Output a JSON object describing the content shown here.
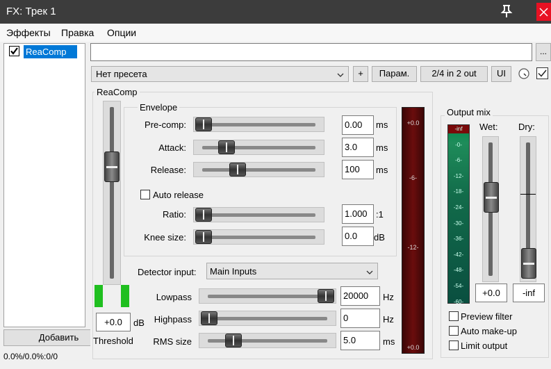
{
  "window": {
    "title": "FX: Трек 1"
  },
  "menu": {
    "items": [
      "Эффекты",
      "Правка",
      "Опции"
    ]
  },
  "fx_list": {
    "items": [
      {
        "label": "ReaComp",
        "enabled": true
      }
    ],
    "add_label": "Добавить",
    "status": "0.0%/0.0%:0/0"
  },
  "toolbar": {
    "name_value": "",
    "ellipsis": "...",
    "preset": "Нет пресета",
    "plus": "+",
    "params": "Парам.",
    "routing": "2/4 in 2 out",
    "ui": "UI",
    "ui_checked": true
  },
  "plugin": {
    "title": "ReaComp",
    "threshold": {
      "value": "+0.0",
      "unit": "dB",
      "label": "Threshold",
      "level": 0.0
    },
    "envelope": {
      "title": "Envelope",
      "precomp": {
        "label": "Pre-comp:",
        "value": "0.00",
        "unit": "ms",
        "pos": 0.0
      },
      "attack": {
        "label": "Attack:",
        "value": "3.0",
        "unit": "ms",
        "pos": 0.21
      },
      "release": {
        "label": "Release:",
        "value": "100",
        "unit": "ms",
        "pos": 0.31
      },
      "auto_release": {
        "label": "Auto release",
        "checked": false
      },
      "ratio": {
        "label": "Ratio:",
        "value": "1.000",
        "unit": ":1",
        "pos": 0.0
      },
      "knee": {
        "label": "Knee size:",
        "value": "0.0",
        "unit": "dB",
        "pos": 0.0
      }
    },
    "detector": {
      "label": "Detector input:",
      "value": "Main Inputs"
    },
    "lowpass": {
      "label": "Lowpass",
      "value": "20000",
      "unit": "Hz",
      "pos": 1.0
    },
    "highpass": {
      "label": "Highpass",
      "value": "0",
      "unit": "Hz",
      "pos": 0.0
    },
    "rms": {
      "label": "RMS size",
      "value": "5.0",
      "unit": "ms",
      "pos": 0.21
    },
    "gr_meter": {
      "top": "+0.0",
      "mid1": "-6-",
      "mid2": "-12-",
      "bottom": "+0.0"
    },
    "output_mix": {
      "title": "Output mix",
      "meter_labels": [
        "-inf",
        "-0-",
        "-6-",
        "-12-",
        "-18-",
        "-24-",
        "-30-",
        "-36-",
        "-42-",
        "-48-",
        "-54-",
        "-60-"
      ],
      "wet": {
        "label": "Wet:",
        "value": "+0.0",
        "level": 0.4
      },
      "dry": {
        "label": "Dry:",
        "value": "-inf",
        "level": 1.0
      },
      "preview_filter": {
        "label": "Preview filter",
        "checked": false
      },
      "auto_makeup": {
        "label": "Auto make-up",
        "checked": false
      },
      "limit_output": {
        "label": "Limit output",
        "checked": false
      }
    }
  },
  "colors": {
    "selection": "#0078d7",
    "titlebar": "#3c3c3c",
    "close": "#e81123",
    "meter_green": "#1fbf1f",
    "gr_meter_bg": "#4a0a0a"
  }
}
